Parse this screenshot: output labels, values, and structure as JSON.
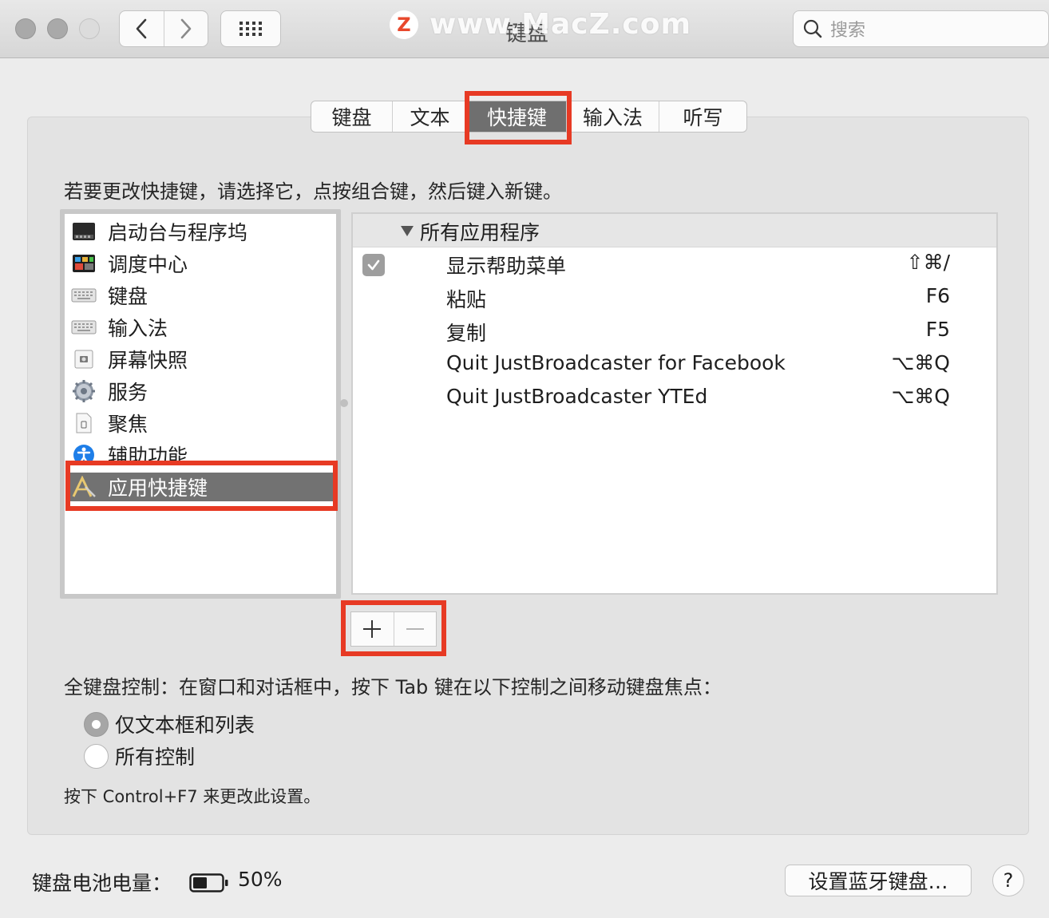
{
  "window": {
    "title": "键盘"
  },
  "watermark": {
    "logo": "Z",
    "text": "www.MacZ.com"
  },
  "search": {
    "placeholder": "搜索"
  },
  "tabs": [
    {
      "label": "键盘",
      "active": false
    },
    {
      "label": "文本",
      "active": false
    },
    {
      "label": "快捷键",
      "active": true
    },
    {
      "label": "输入法",
      "active": false
    },
    {
      "label": "听写",
      "active": false
    }
  ],
  "instruction": "若要更改快捷键，请选择它，点按组合键，然后键入新键。",
  "categories": [
    {
      "label": "启动台与程序坞",
      "icon": "launchpad-dock-icon"
    },
    {
      "label": "调度中心",
      "icon": "mission-control-icon"
    },
    {
      "label": "键盘",
      "icon": "keyboard-icon"
    },
    {
      "label": "输入法",
      "icon": "keyboard-icon"
    },
    {
      "label": "屏幕快照",
      "icon": "screenshot-icon"
    },
    {
      "label": "服务",
      "icon": "gear-icon"
    },
    {
      "label": "聚焦",
      "icon": "spotlight-icon"
    },
    {
      "label": "辅助功能",
      "icon": "accessibility-icon"
    },
    {
      "label": "应用快捷键",
      "icon": "app-shortcuts-icon",
      "selected": true
    }
  ],
  "shortcuts": {
    "group_label": "所有应用程序",
    "rows": [
      {
        "name": "显示帮助菜单",
        "key": "⇧⌘/",
        "checked": true
      },
      {
        "name": "粘贴",
        "key": "F6",
        "checked": false
      },
      {
        "name": "复制",
        "key": "F5",
        "checked": false
      },
      {
        "name": "Quit JustBroadcaster for Facebook",
        "key": "⌥⌘Q",
        "checked": false
      },
      {
        "name": "Quit JustBroadcaster YTEd",
        "key": "⌥⌘Q",
        "checked": false
      }
    ]
  },
  "full_keyboard": {
    "label": "全键盘控制：在窗口和对话框中，按下 Tab 键在以下控制之间移动键盘焦点：",
    "options": [
      {
        "label": "仅文本框和列表",
        "selected": true
      },
      {
        "label": "所有控制",
        "selected": false
      }
    ],
    "hint": "按下 Control+F7 来更改此设置。"
  },
  "battery": {
    "label": "键盘电池电量：",
    "value": "50%",
    "level": 0.5
  },
  "bluetooth_button": "设置蓝牙键盘…",
  "help_button": "?",
  "colors": {
    "highlight": "#e73a24",
    "selected_bg": "#727272"
  }
}
